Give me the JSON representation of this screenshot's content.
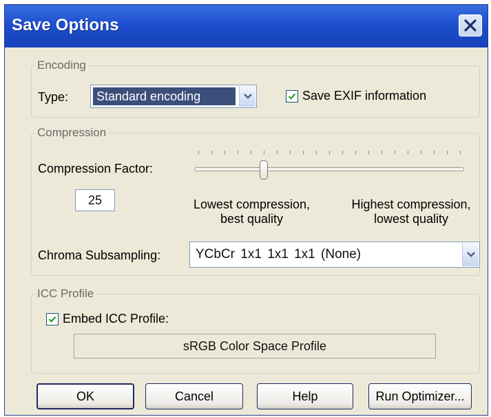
{
  "window": {
    "title": "Save Options"
  },
  "encoding": {
    "group_label": "Encoding",
    "type_label": "Type:",
    "type_value": "Standard encoding",
    "save_exif_label": "Save EXIF information",
    "save_exif_checked": true
  },
  "compression": {
    "group_label": "Compression",
    "factor_label": "Compression Factor:",
    "factor_value": "25",
    "slider_fraction": 0.25,
    "low_label_line1": "Lowest compression,",
    "low_label_line2": "best quality",
    "high_label_line1": "Highest compression,",
    "high_label_line2": "lowest quality",
    "chroma_label": "Chroma Subsampling:",
    "chroma_value": "YCbCr 1x1 1x1 1x1 (None)"
  },
  "icc": {
    "group_label": "ICC Profile",
    "embed_label": "Embed ICC Profile:",
    "embed_checked": true,
    "profile_name": "sRGB Color Space Profile"
  },
  "buttons": {
    "ok": "OK",
    "cancel": "Cancel",
    "help": "Help",
    "run_optimizer": "Run Optimizer..."
  },
  "icons": {
    "close": "close-icon",
    "combo_arrow": "chevron-down-icon",
    "check": "checkmark-icon"
  },
  "colors": {
    "titlebar": "#1d4fcf",
    "dialog_bg": "#ece9d8",
    "selection": "#3b4f7a"
  }
}
